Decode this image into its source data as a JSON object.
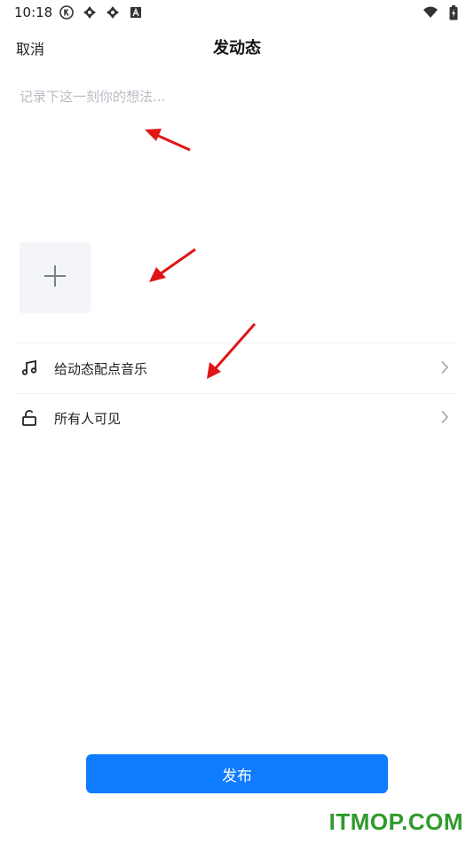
{
  "status_bar": {
    "time": "10:18",
    "left_icons": [
      "k-circle-icon",
      "pinwheel-icon",
      "pinwheel-icon",
      "a-box-icon"
    ],
    "right_icons": [
      "wifi-icon",
      "battery-charging-icon"
    ]
  },
  "nav": {
    "cancel_label": "取消",
    "title": "发动态"
  },
  "composer": {
    "placeholder": "记录下这一刻你的想法...",
    "value": ""
  },
  "media": {
    "add_icon": "plus-icon"
  },
  "options": [
    {
      "label": "给动态配点音乐",
      "icon": "music-note-icon"
    },
    {
      "label": "所有人可见",
      "icon": "unlock-icon"
    }
  ],
  "publish_label": "发布",
  "watermark": "ITMOP.COM",
  "colors": {
    "accent": "#0f7cff",
    "annotation_arrow": "#e01515",
    "watermark": "#2f9a2c",
    "placeholder": "#b8bcc4",
    "media_tile": "#f4f5f8"
  }
}
